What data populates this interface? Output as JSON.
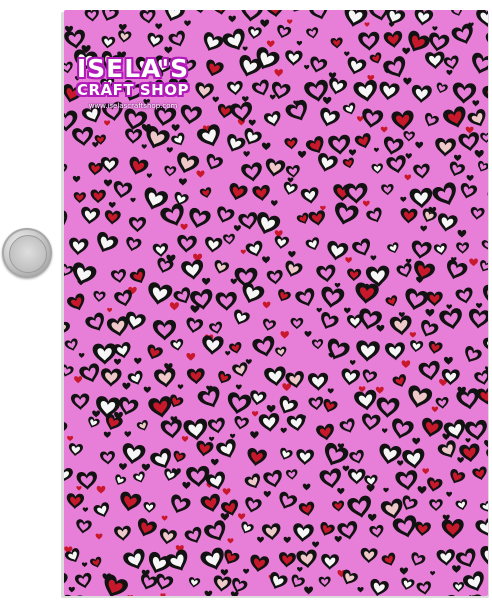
{
  "photo": {
    "subject": "",
    "background_color": "#ffffff",
    "sheet_color": "#e77fd8",
    "heart_colors": {
      "black": "#121212",
      "red": "#c8182b",
      "white": "#f6f6f6",
      "blush": "#efc9c9"
    }
  },
  "watermark": {
    "line1": "ISELA'S",
    "line2": "CRAFT SHOP",
    "url": "www.iselascraftshop.com",
    "outline_color": "#b01ab8"
  },
  "coin": {
    "icon": "coin-icon"
  }
}
